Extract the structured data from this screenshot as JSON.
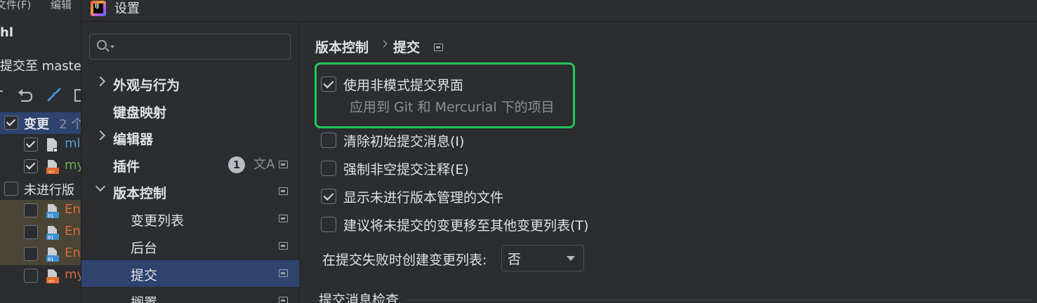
{
  "ide": {
    "menu": [
      "文件(F)",
      "编辑"
    ],
    "project": "hl",
    "commit_to": "提交至 master",
    "changes_label": "变更",
    "changes_count": "2 个",
    "files": [
      "ml",
      "my"
    ],
    "unversioned_label": "未进行版",
    "unversioned_files": [
      "En",
      "En",
      "En",
      "my"
    ]
  },
  "dialog": {
    "title": "设置",
    "search": {
      "placeholder": ""
    },
    "nav": {
      "appearance": "外观与行为",
      "keymap": "键盘映射",
      "editor": "编辑器",
      "plugins": "插件",
      "plugins_badge": "1",
      "vcs": "版本控制",
      "changelists": "变更列表",
      "background": "后台",
      "commit": "提交",
      "shelf": "搁置"
    },
    "breadcrumb": {
      "parent": "版本控制",
      "current": "提交"
    },
    "options": {
      "non_modal": {
        "label": "使用非模式提交界面",
        "checked": true,
        "hint": "应用到 Git 和 Mercurial 下的项目"
      },
      "clear_initial": {
        "label": "清除初始提交消息(I)",
        "checked": false
      },
      "force_comment": {
        "label": "强制非空提交注释(E)",
        "checked": false
      },
      "show_unversioned": {
        "label": "显示未进行版本管理的文件",
        "checked": true
      },
      "suggest_move": {
        "label": "建议将未提交的变更移至其他变更列表(T)",
        "checked": false
      }
    },
    "changelist_on_fail": {
      "label": "在提交失败时创建变更列表:",
      "value": "否"
    },
    "section_title": "提交消息检查"
  },
  "colors": {
    "highlight_box": "#23c55a",
    "selection": "#2e436e"
  }
}
